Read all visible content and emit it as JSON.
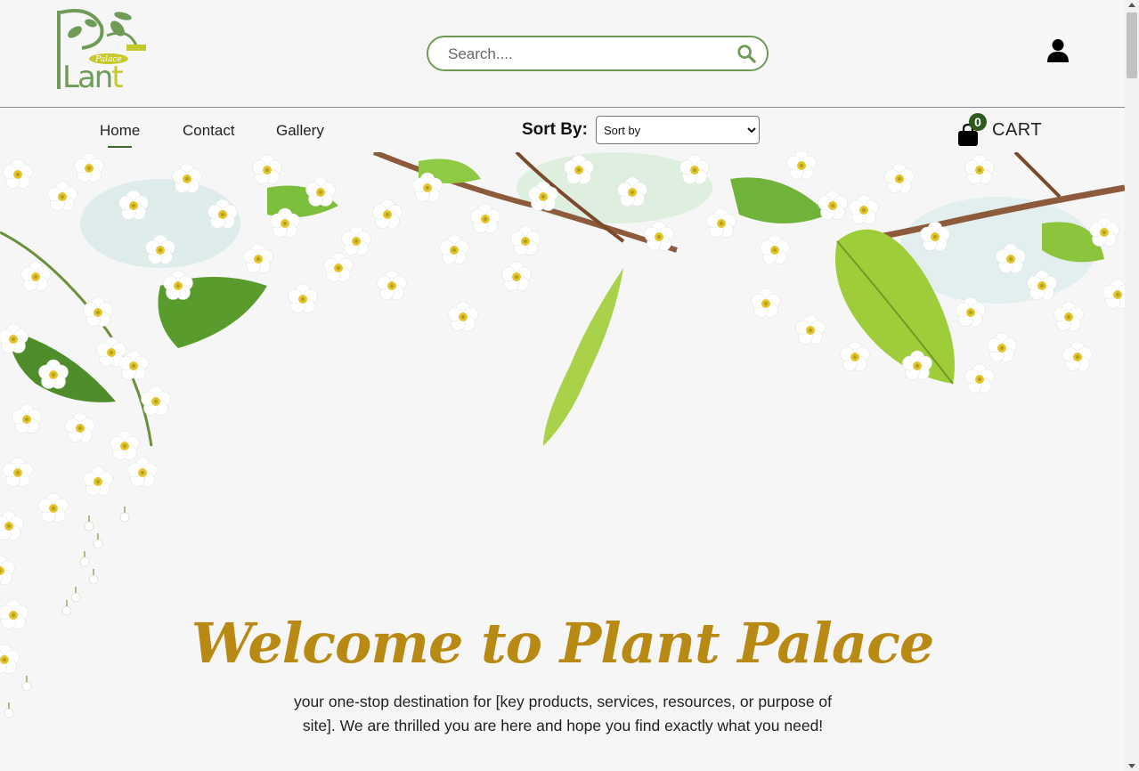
{
  "brand": {
    "logo_word": "Plant",
    "logo_tag": "Palace"
  },
  "search": {
    "placeholder": "Search....",
    "value": ""
  },
  "nav": {
    "items": [
      {
        "label": "Home",
        "active": true
      },
      {
        "label": "Contact",
        "active": false
      },
      {
        "label": "Gallery",
        "active": false
      }
    ]
  },
  "sort": {
    "label": "Sort By:",
    "selected": "Sort by",
    "options": [
      "Sort by"
    ]
  },
  "cart": {
    "count": "0",
    "label": "CART"
  },
  "hero": {
    "title": "Welcome to Plant Palace",
    "text": "your one-stop destination for [key products, services, resources, or purpose of site]. We are thrilled you are here and hope you find exactly what you need!"
  },
  "colors": {
    "accent_green": "#6e9b56",
    "dark_green": "#2f5a1c",
    "title_gold": "#b88a14",
    "logo_yellow": "#c5c92b"
  },
  "icons": {
    "search": "search-icon",
    "user": "user-icon",
    "cart": "shopping-bag-icon"
  }
}
